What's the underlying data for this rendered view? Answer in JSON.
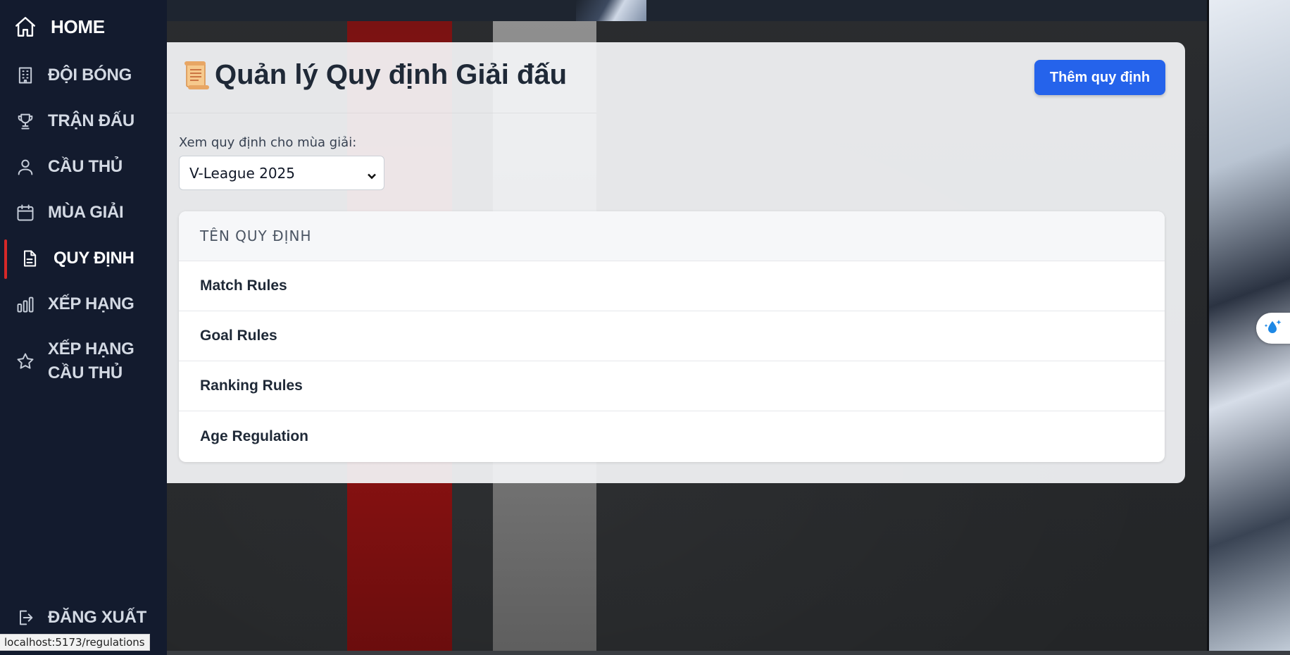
{
  "sidebar": {
    "items": [
      {
        "label": "HOME",
        "icon": "home-icon"
      },
      {
        "label": "ĐỘI BÓNG",
        "icon": "building-icon"
      },
      {
        "label": "TRẬN ĐẤU",
        "icon": "trophy-icon"
      },
      {
        "label": "CẦU THỦ",
        "icon": "user-icon"
      },
      {
        "label": "MÙA GIẢI",
        "icon": "calendar-icon"
      },
      {
        "label": "QUY ĐỊNH",
        "icon": "document-icon",
        "active": true
      },
      {
        "label": "XẾP HẠNG",
        "icon": "bar-chart-icon"
      },
      {
        "label": "XẾP HẠNG CẦU THỦ",
        "icon": "star-icon"
      }
    ],
    "logout": {
      "label": "ĐĂNG XUẤT",
      "icon": "logout-icon"
    },
    "active_color": "#d62828"
  },
  "main": {
    "title": "Quản lý Quy định Giải đấu",
    "title_icon": "scroll-icon",
    "add_button_label": "Thêm quy định",
    "season_label": "Xem quy định cho mùa giải:",
    "season_selected": "V-League 2025",
    "table": {
      "header": "TÊN QUY ĐỊNH",
      "rows": [
        "Match Rules",
        "Goal Rules",
        "Ranking Rules",
        "Age Regulation"
      ]
    }
  },
  "status_bar": {
    "url": "localhost:5173/regulations"
  },
  "colors": {
    "accent": "#2563eb",
    "sidebar_bg": "#131b2e"
  }
}
